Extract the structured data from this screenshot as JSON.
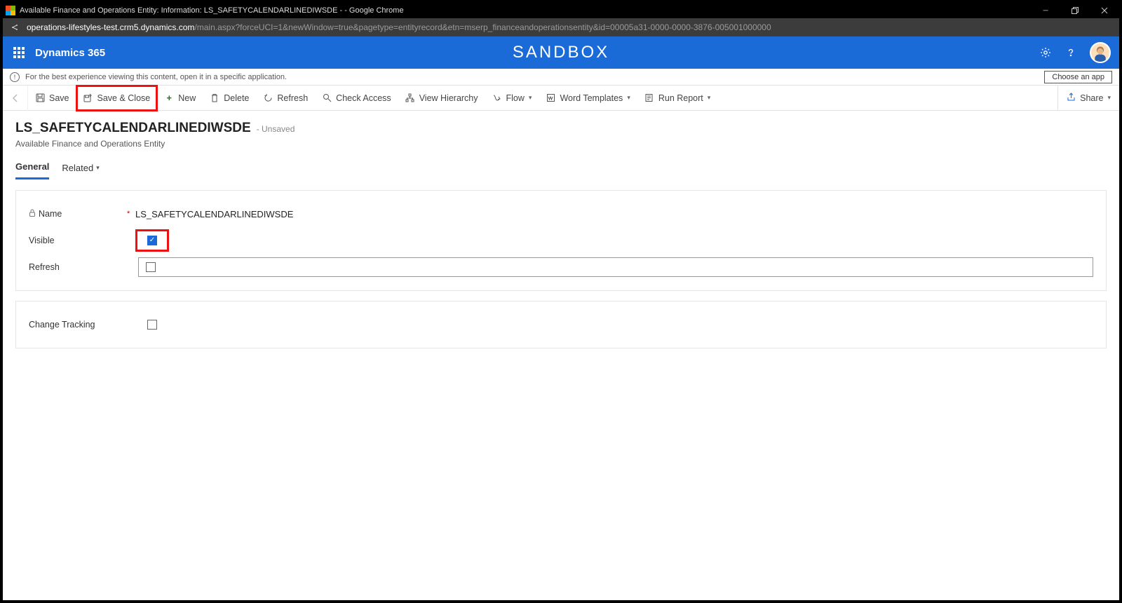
{
  "browser": {
    "tab_title": "Available Finance and Operations Entity: Information: LS_SAFETYCALENDARLINEDIWSDE - - Google Chrome",
    "url_host": "operations-lifestyles-test.crm5.dynamics.com",
    "url_path": "/main.aspx?forceUCI=1&newWindow=true&pagetype=entityrecord&etn=mserp_financeandoperationsentity&id=00005a31-0000-0000-3876-005001000000"
  },
  "header": {
    "app_name": "Dynamics 365",
    "env_label": "SANDBOX"
  },
  "infobar": {
    "text": "For the best experience viewing this content, open it in a specific application.",
    "choose_btn": "Choose an app"
  },
  "cmdbar": {
    "save": "Save",
    "save_close": "Save & Close",
    "new": "New",
    "delete": "Delete",
    "refresh": "Refresh",
    "check_access": "Check Access",
    "view_hierarchy": "View Hierarchy",
    "flow": "Flow",
    "word_templates": "Word Templates",
    "run_report": "Run Report",
    "share": "Share"
  },
  "record": {
    "title": "LS_SAFETYCALENDARLINEDIWSDE",
    "status": "- Unsaved",
    "subtitle": "Available Finance and Operations Entity"
  },
  "tabs": {
    "general": "General",
    "related": "Related"
  },
  "form": {
    "name_label": "Name",
    "name_value": "LS_SAFETYCALENDARLINEDIWSDE",
    "visible_label": "Visible",
    "visible_checked": true,
    "refresh_label": "Refresh",
    "refresh_checked": false,
    "change_tracking_label": "Change Tracking",
    "change_tracking_checked": false
  }
}
